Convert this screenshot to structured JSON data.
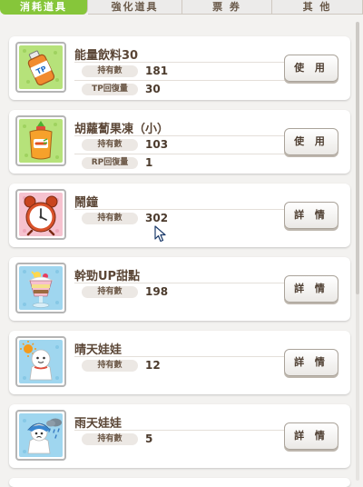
{
  "tabs": [
    {
      "label": "消耗道具",
      "active": true
    },
    {
      "label": "強化道具",
      "active": false
    },
    {
      "label": "票 券",
      "active": false
    },
    {
      "label": "其 他",
      "active": false
    }
  ],
  "items": [
    {
      "name": "能量飲料30",
      "icon": "tp-drink-icon",
      "stats": [
        {
          "label": "持有數",
          "value": "181"
        },
        {
          "label": "TP回復量",
          "value": "30"
        }
      ],
      "button": "使 用"
    },
    {
      "name": "胡蘿蔔果凍（小）",
      "icon": "carrot-jelly-icon",
      "stats": [
        {
          "label": "持有數",
          "value": "103"
        },
        {
          "label": "RP回復量",
          "value": "1"
        }
      ],
      "button": "使 用"
    },
    {
      "name": "鬧鐘",
      "icon": "alarm-clock-icon",
      "stats": [
        {
          "label": "持有數",
          "value": "302"
        }
      ],
      "button": "詳 情"
    },
    {
      "name": "幹勁UP甜點",
      "icon": "parfait-icon",
      "stats": [
        {
          "label": "持有數",
          "value": "198"
        }
      ],
      "button": "詳 情"
    },
    {
      "name": "晴天娃娃",
      "icon": "sunny-doll-icon",
      "stats": [
        {
          "label": "持有數",
          "value": "12"
        }
      ],
      "button": "詳 情"
    },
    {
      "name": "雨天娃娃",
      "icon": "rainy-doll-icon",
      "stats": [
        {
          "label": "持有數",
          "value": "5"
        }
      ],
      "button": "詳 情"
    }
  ],
  "colors": {
    "tab_active": "#86c63a",
    "text_brown": "#5b4636"
  }
}
